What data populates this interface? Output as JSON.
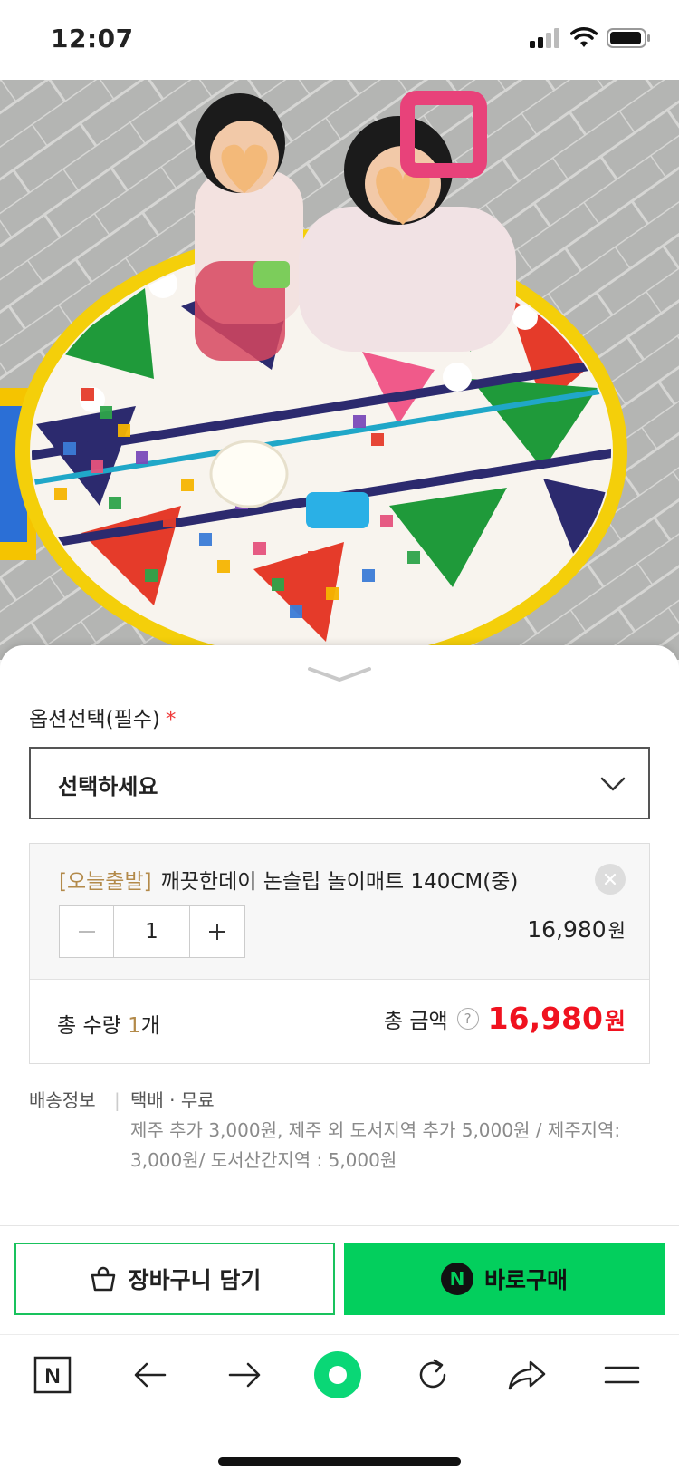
{
  "status_bar": {
    "time": "12:07"
  },
  "product_photo": {
    "alt": "product-photo-play-mat"
  },
  "option": {
    "label": "옵션선택(필수)",
    "required_mark": "*",
    "select_value": "선택하세요"
  },
  "selected_item": {
    "tag": "[오늘출발]",
    "name": "깨끗한데이 논슬립 놀이매트 140CM(중)",
    "quantity": "1",
    "price": "16,980",
    "currency": "원"
  },
  "summary": {
    "qty_label_prefix": "총 수량 ",
    "qty_value": "1",
    "qty_unit": "개",
    "amount_label": "총 금액",
    "help": "?",
    "total": "16,980",
    "currency": "원"
  },
  "shipping": {
    "label": "배송정보",
    "separator": "|",
    "value": "택배 · 무료",
    "detail": "제주 추가 3,000원, 제주 외 도서지역 추가 5,000원 / 제주지역: 3,000원/ 도서산간지역 : 5,000원"
  },
  "buttons": {
    "cart": "장바구니 담기",
    "buy": "바로구매",
    "npay_mark": "N"
  },
  "browser_nav": {
    "items": [
      "naver-home-icon",
      "back-icon",
      "forward-icon",
      "green-dot-icon",
      "reload-icon",
      "share-icon",
      "menu-icon"
    ],
    "home_label": "N"
  },
  "colors": {
    "buy_green": "#03cf5d",
    "price_red": "#f0121f",
    "tag_gold": "#b38a4a",
    "required_red": "#f03a3a"
  }
}
